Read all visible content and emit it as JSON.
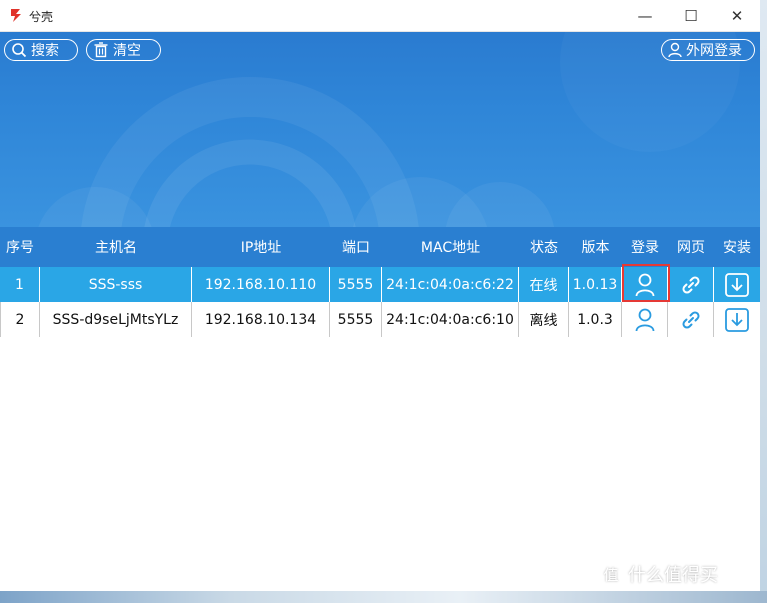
{
  "window": {
    "title": "兮壳",
    "minimize": "—",
    "maximize": "☐",
    "close": "✕"
  },
  "toolbar": {
    "search_label": "搜索",
    "clear_label": "清空",
    "external_login_label": "外网登录"
  },
  "table": {
    "headers": [
      "序号",
      "主机名",
      "IP地址",
      "端口",
      "MAC地址",
      "状态",
      "版本",
      "登录",
      "网页",
      "安装"
    ],
    "rows": [
      {
        "index": "1",
        "hostname": "SSS-sss",
        "ip": "192.168.10.110",
        "port": "5555",
        "mac": "24:1c:04:0a:c6:22",
        "status": "在线",
        "version": "1.0.13",
        "selected": true
      },
      {
        "index": "2",
        "hostname": "SSS-d9seLjMtsYLz",
        "ip": "192.168.10.134",
        "port": "5555",
        "mac": "24:1c:04:0a:c6:10",
        "status": "离线",
        "version": "1.0.3",
        "selected": false
      }
    ],
    "row_icons": {
      "login": "user-icon",
      "web": "link-icon",
      "install": "download-icon"
    }
  },
  "watermark": {
    "badge": "值",
    "text": "什么值得买"
  },
  "colors": {
    "banner": "#2a7bd0",
    "header": "#2a7fd1",
    "selected_row": "#2aa6e6",
    "icon_blue": "#2a9be0",
    "highlight": "#e53935"
  }
}
